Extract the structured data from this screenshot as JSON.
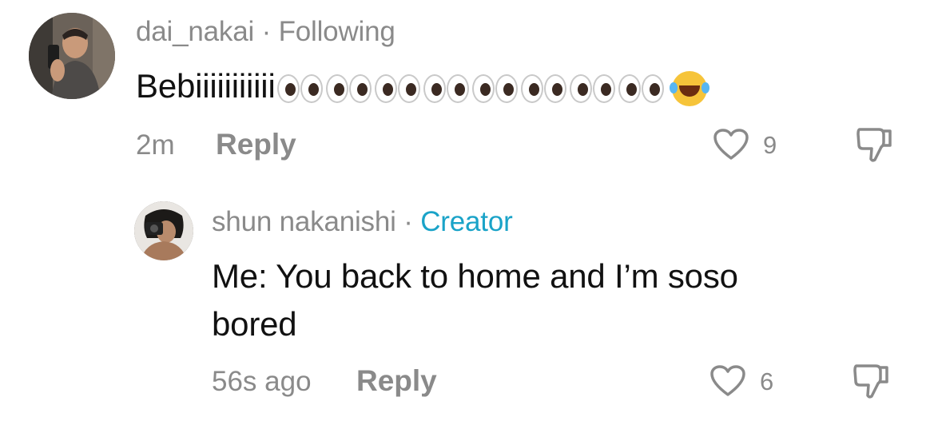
{
  "comments": [
    {
      "username": "dai_nakai",
      "separator": "·",
      "relation": "Following",
      "text": "Bebiiiiiiiiiii",
      "emoji_eyes_count": 8,
      "time": "2m",
      "reply_label": "Reply",
      "likes": "9",
      "icons": [
        "avatar",
        "eyes-emoji",
        "laughing-tears-emoji",
        "heart-icon",
        "dislike-icon"
      ]
    },
    {
      "username": "shun nakanishi",
      "separator": "·",
      "relation": "Creator",
      "text_line1": "Me: You back to home and I’m soso",
      "text_line2": "bored",
      "time": "56s ago",
      "reply_label": "Reply",
      "likes": "6",
      "icons": [
        "avatar",
        "heart-icon",
        "dislike-icon"
      ]
    }
  ],
  "colors": {
    "meta": "#8a8a8a",
    "creator": "#1aa3c8",
    "text": "#111111"
  }
}
